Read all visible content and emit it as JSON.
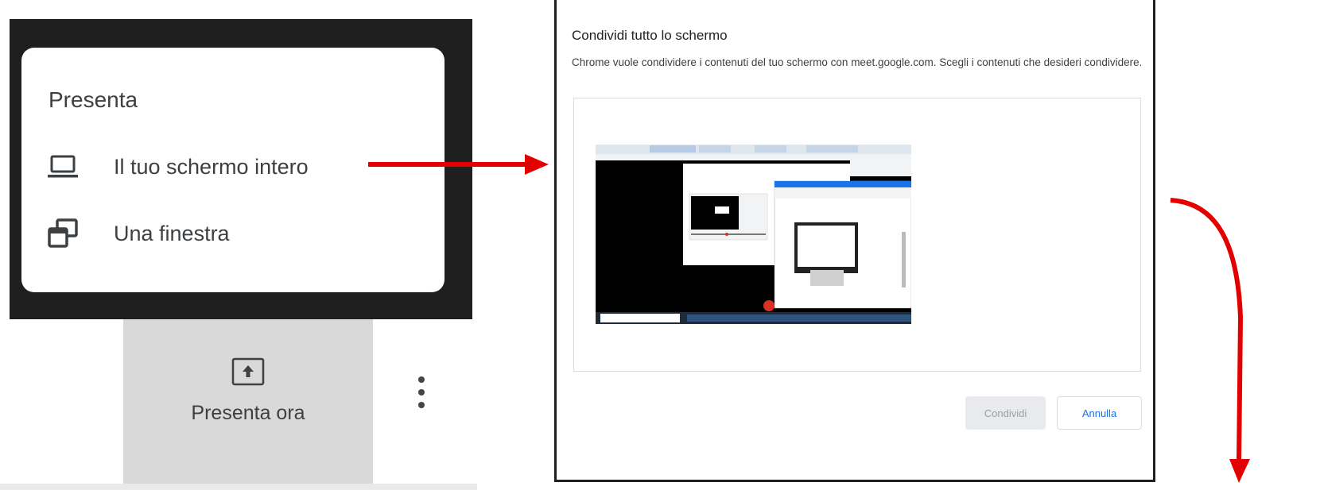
{
  "present_menu": {
    "title": "Presenta",
    "items": [
      {
        "label": "Il tuo schermo intero",
        "icon": "laptop-icon"
      },
      {
        "label": "Una finestra",
        "icon": "window-icon"
      }
    ]
  },
  "bottom_bar": {
    "present_now_label": "Presenta ora",
    "present_icon": "present-screen-icon",
    "more_icon": "more-vert-icon"
  },
  "share_dialog": {
    "title": "Condividi tutto lo schermo",
    "description": "Chrome vuole condividere i contenuti del tuo schermo con meet.google.com. Scegli i contenuti che desideri condividere.",
    "share_button": "Condividi",
    "cancel_button": "Annulla"
  },
  "colors": {
    "arrow": "#e30000",
    "cancel_text": "#1a73e8"
  }
}
